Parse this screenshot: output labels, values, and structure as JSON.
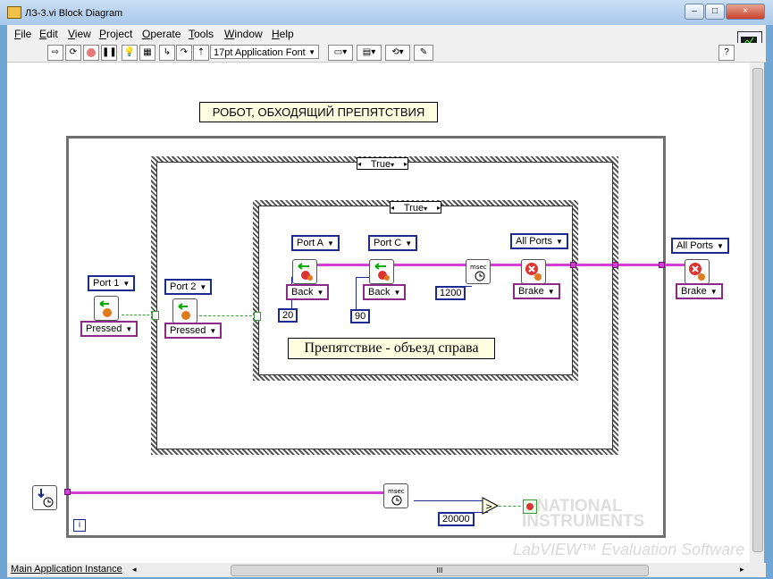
{
  "window": {
    "title": "ЛЗ-3.vi Block Diagram",
    "controls": [
      "‒",
      "□",
      "×"
    ]
  },
  "menu": [
    {
      "label": "File",
      "u": "F",
      "rest": "ile"
    },
    {
      "label": "Edit",
      "u": "E",
      "rest": "dit"
    },
    {
      "label": "View",
      "u": "V",
      "rest": "iew"
    },
    {
      "label": "Project",
      "u": "P",
      "rest": "roject"
    },
    {
      "label": "Operate",
      "u": "O",
      "rest": "perate"
    },
    {
      "label": "Tools",
      "u": "T",
      "rest": "ools"
    },
    {
      "label": "Window",
      "u": "W",
      "rest": "indow"
    },
    {
      "label": "Help",
      "u": "H",
      "rest": "elp"
    }
  ],
  "toolbar": {
    "font": "17pt Application Font",
    "help_glyph": "?"
  },
  "diagram": {
    "heading": "РОБОТ,  ОБХОДЯЩИЙ  ПРЕПЯТСТВИЯ",
    "outer_case_selector": "True",
    "inner_case_selector": "True",
    "inner_note": "Препятствие  -  объезд справа",
    "sensor1": {
      "port": "Port 1",
      "state": "Pressed"
    },
    "sensor2": {
      "port": "Port 2",
      "state": "Pressed"
    },
    "motorA": {
      "port": "Port A",
      "direction": "Back",
      "power": "20"
    },
    "motorC": {
      "port": "Port C",
      "direction": "Back",
      "power": "90"
    },
    "wait": {
      "label": "msec",
      "value": "1200"
    },
    "stop_inner": {
      "port": "All Ports",
      "mode": "Brake"
    },
    "stop_outer": {
      "port": "All Ports",
      "mode": "Brake"
    },
    "timer": {
      "label": "msec",
      "limit": "20000"
    },
    "loop_index": "i"
  },
  "statusbar": {
    "instance": "Main Application Instance",
    "hscroll_glyph": "III"
  },
  "watermark": {
    "line1": "NATIONAL",
    "line2": "INSTRUMENTS",
    "line3": "LabVIEW™ Evaluation Software"
  },
  "colors": {
    "wire_pink": "#d23fd2",
    "ring_blue": "#1c2b8f",
    "title_gradient": "#a9c8ea"
  }
}
